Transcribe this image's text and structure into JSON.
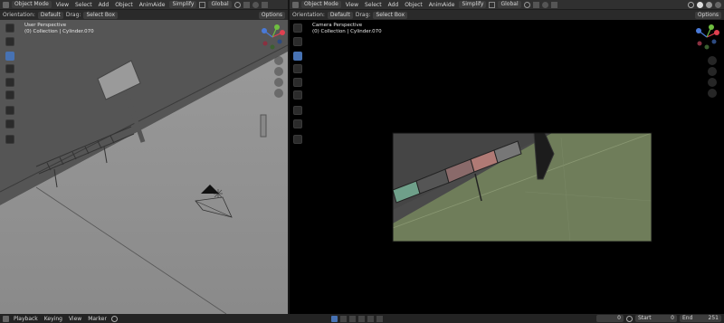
{
  "left": {
    "header": {
      "mode": "Object Mode",
      "menus": [
        "View",
        "Select",
        "Add",
        "Object",
        "AnimAide"
      ],
      "simplify": "Simplify",
      "orientation_value": "Global"
    },
    "toolrow": {
      "orientation_label": "Orientation:",
      "orientation_value": "Default",
      "drag_label": "Drag:",
      "drag_value": "Select Box",
      "options": "Options"
    },
    "viewport": {
      "title": "User Perspective",
      "subtitle": "(0) Collection | Cylinder.070"
    }
  },
  "right": {
    "header": {
      "mode": "Object Mode",
      "menus": [
        "View",
        "Select",
        "Add",
        "Object",
        "AnimAide"
      ],
      "simplify": "Simplify",
      "orientation_value": "Global"
    },
    "toolrow": {
      "orientation_label": "Orientation:",
      "orientation_value": "Default",
      "drag_label": "Drag:",
      "drag_value": "Select Box",
      "options": "Options"
    },
    "viewport": {
      "title": "Camera Perspective",
      "subtitle": "(0) Collection | Cylinder.070"
    }
  },
  "timeline": {
    "menus": [
      "Playback",
      "Keying",
      "View",
      "Marker"
    ],
    "current_frame": "0",
    "start_label": "Start",
    "start_value": "0",
    "end_label": "End",
    "end_value": "251"
  },
  "colors": {
    "accent": "#4772b3",
    "header_bg": "#303030",
    "left_viewport_bg": "#8a8a8a",
    "right_viewport_bg": "#000000",
    "camera_frame_green": "#6f7d5a"
  },
  "icons": [
    "select-box-icon",
    "cursor-icon",
    "move-icon",
    "rotate-icon",
    "scale-icon",
    "transform-icon",
    "annotate-icon",
    "measure-icon",
    "add-cube-icon",
    "zoom-icon",
    "hand-icon",
    "camera-icon",
    "grid-icon"
  ]
}
